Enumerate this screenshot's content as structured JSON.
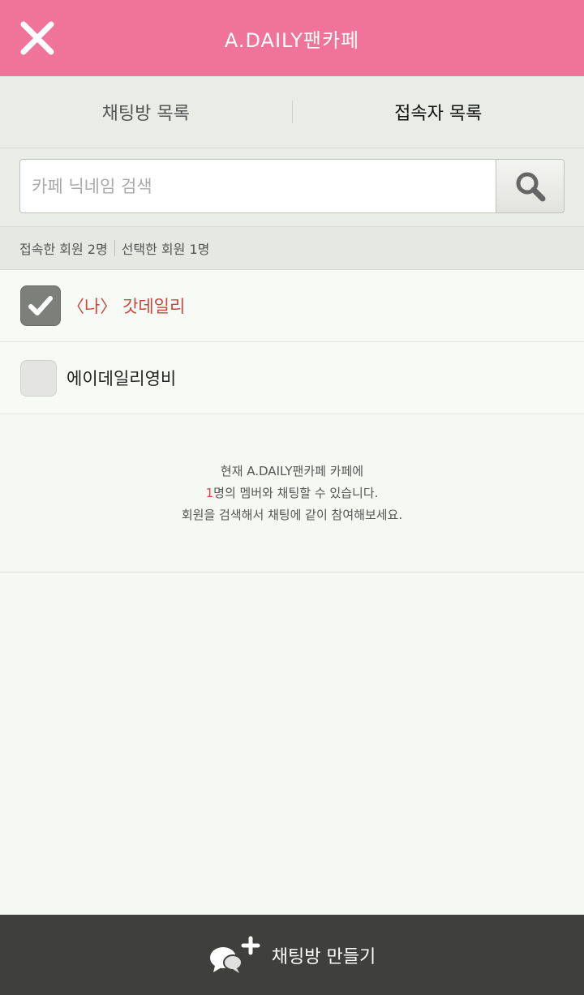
{
  "header": {
    "title": "A.DAILY팬카페",
    "close_icon": "close-icon",
    "background": "#f07399"
  },
  "tabs": [
    {
      "label": "채팅방 목록",
      "active": false
    },
    {
      "label": "접속자 목록",
      "active": true
    }
  ],
  "search": {
    "placeholder": "카페 닉네임 검색",
    "value": "",
    "icon": "search-icon"
  },
  "counts": {
    "connected": "접속한 회원 2명",
    "selected": "선택한 회원 1명"
  },
  "members": [
    {
      "name": "〈나〉 갓데일리",
      "checked": true,
      "is_me": true
    },
    {
      "name": "에이데일리영비",
      "checked": false,
      "is_me": false
    }
  ],
  "info": {
    "line1": "현재 A.DAILY팬카페 카페에",
    "line2_number": "1",
    "line2_text": "명의 멤버와 채팅할 수 있습니다.",
    "line3": "회원을 검색해서 채팅에 같이 참여해보세요.",
    "accent_color": "#d0473c"
  },
  "footer": {
    "label": "채팅방 만들기",
    "icon": "chat-add-icon"
  }
}
